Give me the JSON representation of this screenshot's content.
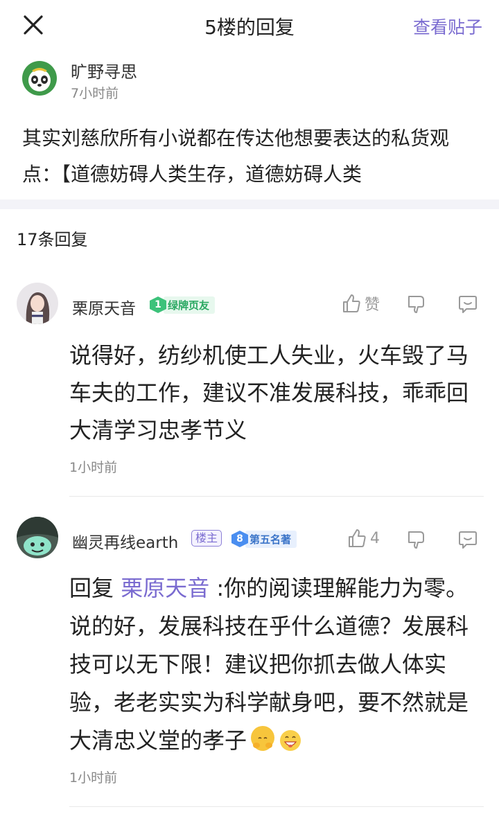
{
  "header": {
    "title": "5楼的回复",
    "view_post": "查看贴子"
  },
  "op": {
    "name": "旷野寻思",
    "time": "7小时前",
    "content": "其实刘慈欣所有小说都在传达他想要表达的私货观点：【道德妨碍人类生存，道德妨碍人类"
  },
  "reply_count": "17条回复",
  "replies": [
    {
      "name": "栗原天音",
      "level": "1",
      "badge": "绿牌页友",
      "like_label": "赞",
      "content": "说得好，纺纱机使工人失业，火车毁了马车夫的工作，建议不准发展科技，乖乖回大清学习忠孝节义",
      "time": "1小时前"
    },
    {
      "name": "幽灵再线earth",
      "owner_tag": "楼主",
      "level": "8",
      "badge": "第五名著",
      "like_count": "4",
      "reply_prefix": "回复",
      "mention": "栗原天音",
      "content": " :你的阅读理解能力为零。说的好，发展科技在乎什么道德？发展科技可以无下限！建议把你抓去做人体实验，老老实实为科学献身吧，要不然就是大清忠义堂的孝子",
      "time": "1小时前"
    }
  ],
  "colors": {
    "accent": "#7a6bd0",
    "green_badge": "#3cc27a",
    "blue_badge": "#4a8ef0"
  }
}
